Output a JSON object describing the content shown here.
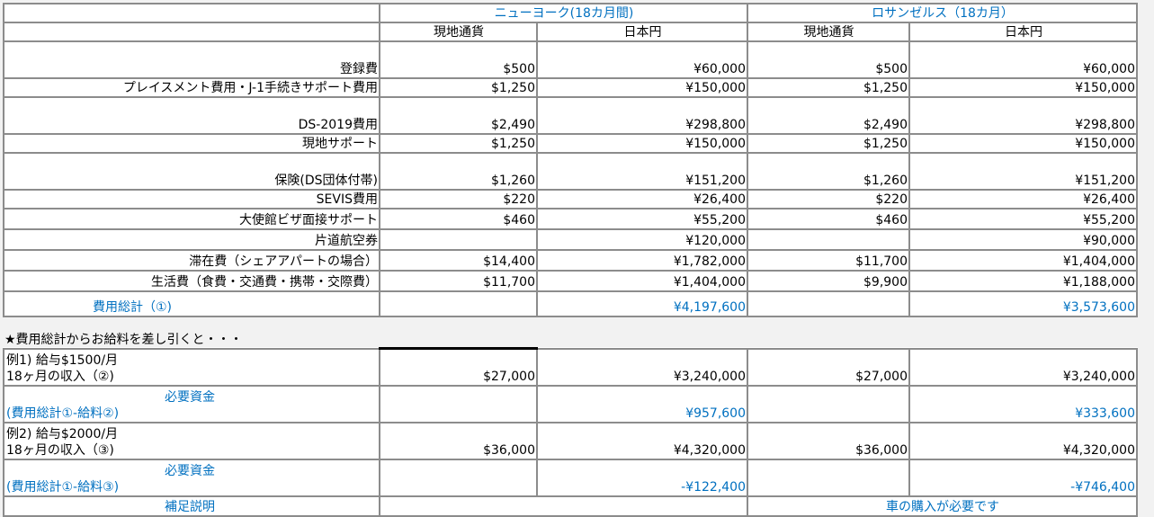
{
  "header": {
    "ny": "ニューヨーク(18カ月間)",
    "la": "ロサンゼルス（18カ月）",
    "local": "現地通貨",
    "jpy": "日本円"
  },
  "rows": [
    {
      "label": "登録費",
      "ny_local": "$500",
      "ny_jpy": "¥60,000",
      "la_local": "$500",
      "la_jpy": "¥60,000"
    },
    {
      "label": "プレイスメント費用・J-1手続きサポート費用",
      "ny_local": "$1,250",
      "ny_jpy": "¥150,000",
      "la_local": "$1,250",
      "la_jpy": "¥150,000"
    },
    {
      "label": "DS-2019費用",
      "ny_local": "$2,490",
      "ny_jpy": "¥298,800",
      "la_local": "$2,490",
      "la_jpy": "¥298,800"
    },
    {
      "label": "現地サポート",
      "ny_local": "$1,250",
      "ny_jpy": "¥150,000",
      "la_local": "$1,250",
      "la_jpy": "¥150,000"
    },
    {
      "label": "保険(DS団体付帯)",
      "ny_local": "$1,260",
      "ny_jpy": "¥151,200",
      "la_local": "$1,260",
      "la_jpy": "¥151,200"
    },
    {
      "label": "SEVIS費用",
      "ny_local": "$220",
      "ny_jpy": "¥26,400",
      "la_local": "$220",
      "la_jpy": "¥26,400"
    },
    {
      "label": "大使館ビザ面接サポート",
      "ny_local": "$460",
      "ny_jpy": "¥55,200",
      "la_local": "$460",
      "la_jpy": "¥55,200"
    },
    {
      "label": "片道航空券",
      "ny_local": "",
      "ny_jpy": "¥120,000",
      "la_local": "",
      "la_jpy": "¥90,000"
    },
    {
      "label": "滞在費（シェアアパートの場合）",
      "ny_local": "$14,400",
      "ny_jpy": "¥1,782,000",
      "la_local": "$11,700",
      "la_jpy": "¥1,404,000"
    },
    {
      "label": "生活費（食費・交通費・携帯・交際費）",
      "ny_local": "$11,700",
      "ny_jpy": "¥1,404,000",
      "la_local": "$9,900",
      "la_jpy": "¥1,188,000"
    }
  ],
  "total": {
    "label": "費用総計（①)",
    "ny_jpy": "¥4,197,600",
    "la_jpy": "¥3,573,600"
  },
  "note": "★費用総計からお給料を差し引くと・・・",
  "examples": [
    {
      "line1": "例1) 給与$1500/月",
      "line2": "18ヶ月の収入（②)",
      "ny_local": "$27,000",
      "ny_jpy": "¥3,240,000",
      "la_local": "$27,000",
      "la_jpy": "¥3,240,000",
      "need_label": "必要資金",
      "need_formula": "(費用総計①-給料②)",
      "need_ny": "¥957,600",
      "need_la": "¥333,600"
    },
    {
      "line1": "例2) 給与$2000/月",
      "line2": "18ヶ月の収入（③)",
      "ny_local": "$36,000",
      "ny_jpy": "¥4,320,000",
      "la_local": "$36,000",
      "la_jpy": "¥4,320,000",
      "need_label": "必要資金",
      "need_formula": "(費用総計①-給料③)",
      "need_ny": "-¥122,400",
      "need_la": "-¥746,400"
    }
  ],
  "footer": {
    "label": "補足説明",
    "la_note": "車の購入が必要です"
  }
}
